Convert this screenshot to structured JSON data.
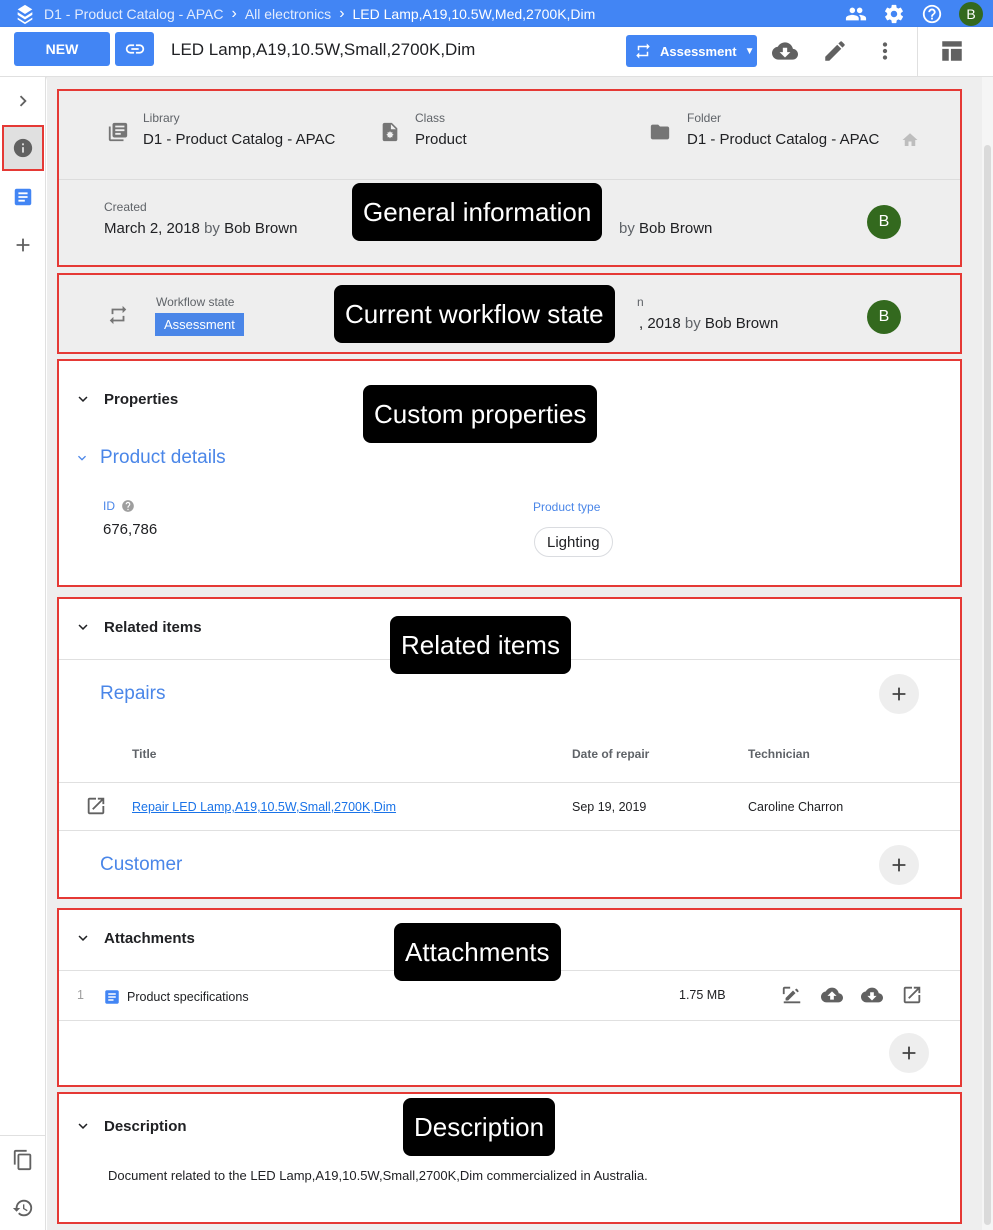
{
  "breadcrumbs": {
    "library": "D1 - Product Catalog - APAC",
    "folder": "All electronics",
    "current": "LED Lamp,A19,10.5W,Med,2700K,Dim"
  },
  "user_initial": "B",
  "toolbar": {
    "new_label": "NEW",
    "document_title": "LED Lamp,A19,10.5W,Small,2700K,Dim",
    "state_label": "Assessment"
  },
  "general": {
    "library_label": "Library",
    "library_value": "D1 - Product Catalog - APAC",
    "class_label": "Class",
    "class_value": "Product",
    "folder_label": "Folder",
    "folder_value": "D1 - Product Catalog - APAC",
    "created_label": "Created",
    "created_date": "March 2, 2018",
    "by": "by",
    "created_user": "Bob Brown",
    "modified_suffix": "by",
    "modified_user": "Bob Brown",
    "avatar": "B"
  },
  "workflow": {
    "state_label": "Workflow state",
    "state_value": "Assessment",
    "partial_label": "n",
    "partial_date": ", 2018",
    "by": "by",
    "user": "Bob Brown",
    "avatar": "B"
  },
  "properties": {
    "heading": "Properties",
    "group": "Product details",
    "id_label": "ID",
    "id_value": "676,786",
    "type_label": "Product type",
    "type_value": "Lighting"
  },
  "related": {
    "heading": "Related items",
    "repairs": "Repairs",
    "columns": [
      "Title",
      "Date of repair",
      "Technician"
    ],
    "rows": [
      {
        "title": "Repair LED Lamp,A19,10.5W,Small,2700K,Dim",
        "date": "Sep 19, 2019",
        "technician": "Caroline Charron"
      }
    ],
    "customer": "Customer"
  },
  "attachments": {
    "heading": "Attachments",
    "items": [
      {
        "index": "1",
        "name": "Product specifications",
        "size": "1.75 MB"
      }
    ]
  },
  "description": {
    "heading": "Description",
    "text": "Document related to the LED Lamp,A19,10.5W,Small,2700K,Dim commercialized in Australia."
  },
  "annotations": {
    "general": "General information",
    "workflow": "Current workflow state",
    "custom": "Custom properties",
    "related": "Related items",
    "attachments": "Attachments",
    "description": "Description"
  },
  "colors": {
    "primary": "#4285f4",
    "highlight": "#e53935",
    "avatar": "#33691e",
    "link": "#1a73e8"
  }
}
